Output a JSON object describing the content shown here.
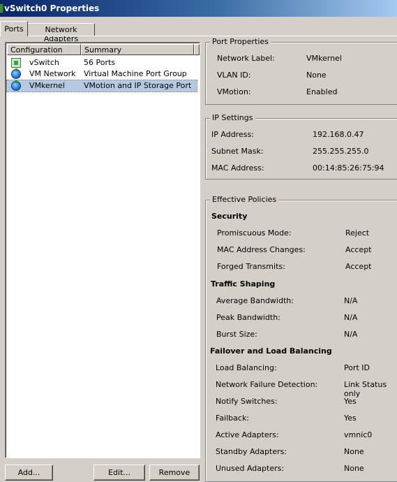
{
  "window": {
    "title": "vSwitch0 Properties"
  },
  "tabs": [
    {
      "label": "Ports",
      "active": true
    },
    {
      "label": "Network Adapters",
      "active": false
    }
  ],
  "list": {
    "columns": [
      "Configuration",
      "Summary"
    ],
    "rows": [
      {
        "name": "vSwitch",
        "summary": "56 Ports",
        "icon": "vswitch-icon",
        "selected": false
      },
      {
        "name": "VM Network",
        "summary": "Virtual Machine Port Group",
        "icon": "globe-icon",
        "selected": false
      },
      {
        "name": "VMkernel",
        "summary": "VMotion and IP Storage Port",
        "icon": "globe-icon",
        "selected": true
      }
    ]
  },
  "buttons": {
    "add": "Add...",
    "edit": "Edit...",
    "remove": "Remove"
  },
  "port_properties": {
    "title": "Port Properties",
    "network_label": {
      "label": "Network Label:",
      "value": "VMkernel"
    },
    "vlan_id": {
      "label": "VLAN ID:",
      "value": "None"
    },
    "vmotion": {
      "label": "VMotion:",
      "value": "Enabled"
    }
  },
  "ip_settings": {
    "title": "IP Settings",
    "ip_address": {
      "label": "IP Address:",
      "value": "192.168.0.47"
    },
    "subnet_mask": {
      "label": "Subnet Mask:",
      "value": "255.255.255.0"
    },
    "mac_address": {
      "label": "MAC Address:",
      "value": "00:14:85:26:75:94"
    }
  },
  "effective_policies": {
    "title": "Effective Policies",
    "security": {
      "title": "Security",
      "promiscuous": {
        "label": "Promiscuous Mode:",
        "value": "Reject"
      },
      "mac_changes": {
        "label": "MAC Address Changes:",
        "value": "Accept"
      },
      "forged": {
        "label": "Forged Transmits:",
        "value": "Accept"
      }
    },
    "traffic_shaping": {
      "title": "Traffic Shaping",
      "avg_bw": {
        "label": "Average Bandwidth:",
        "value": "N/A"
      },
      "peak_bw": {
        "label": "Peak Bandwidth:",
        "value": "N/A"
      },
      "burst": {
        "label": "Burst Size:",
        "value": "N/A"
      }
    },
    "failover": {
      "title": "Failover and Load Balancing",
      "load_balancing": {
        "label": "Load Balancing:",
        "value": "Port ID"
      },
      "failure_detection": {
        "label": "Network Failure Detection:",
        "value": "Link Status only"
      },
      "notify": {
        "label": "Notify Switches:",
        "value": "Yes"
      },
      "failback": {
        "label": "Failback:",
        "value": "Yes"
      },
      "active": {
        "label": "Active Adapters:",
        "value": "vmnic0"
      },
      "standby": {
        "label": "Standby Adapters:",
        "value": "None"
      },
      "unused": {
        "label": "Unused Adapters:",
        "value": "None"
      }
    }
  }
}
